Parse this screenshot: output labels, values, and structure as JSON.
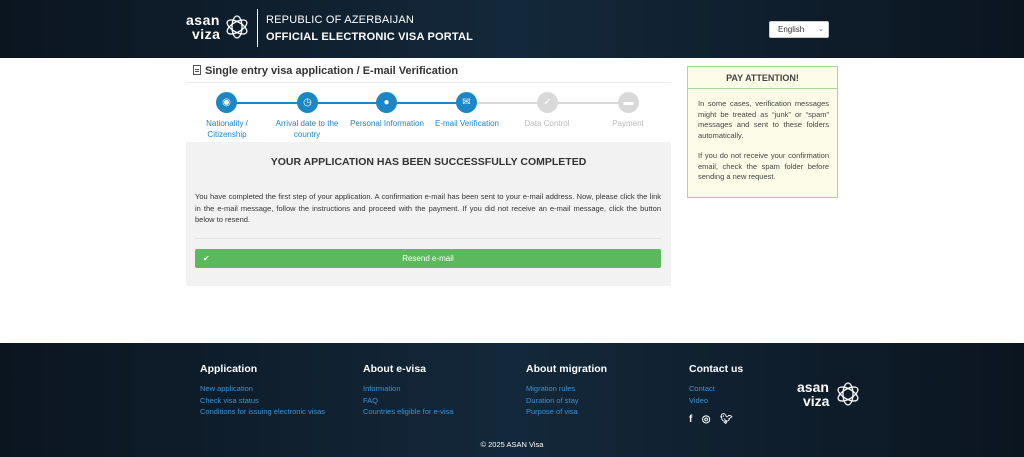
{
  "header": {
    "logo_line1": "asan",
    "logo_line2": "viza",
    "country": "REPUBLIC OF AZERBAIJAN",
    "portal": "OFFICIAL ELECTRONIC VISA PORTAL",
    "language": "English"
  },
  "page_title": "Single entry visa application / E-mail Verification",
  "steps": [
    {
      "label": "Nationality / Citizenship",
      "state": "active",
      "icon": "globe-icon",
      "glyph": "◉"
    },
    {
      "label": "Arrival date to the country",
      "state": "active",
      "icon": "clock-icon",
      "glyph": "◷"
    },
    {
      "label": "Personal Information",
      "state": "active",
      "icon": "user-icon",
      "glyph": "●"
    },
    {
      "label": "E-mail Verification",
      "state": "active",
      "icon": "envelope-icon",
      "glyph": "✉"
    },
    {
      "label": "Data Control",
      "state": "inactive",
      "icon": "check-circle-icon",
      "glyph": "✓"
    },
    {
      "label": "Payment",
      "state": "inactive",
      "icon": "credit-card-icon",
      "glyph": "▬"
    }
  ],
  "panel": {
    "heading": "YOUR APPLICATION HAS BEEN SUCCESSFULLY COMPLETED",
    "text": "You have completed the first step of your application. A confirmation e-mail has been sent to your e-mail address. Now, please click the link in the e-mail message, follow the instructions and proceed with the payment. If you did not receive an e-mail message, click the button below to resend.",
    "button": "Resend e-mail"
  },
  "attention": {
    "title": "PAY ATTENTION!",
    "p1": "In some cases, verification messages might be treated as “junk” or “spam” messages and sent to these folders automatically.",
    "p2": "If you do not receive your confirmation email, check the spam folder before sending a new request."
  },
  "footer": {
    "columns": [
      {
        "title": "Application",
        "links": [
          "New application",
          "Check visa status",
          "Conditions for issuing electronic visas"
        ]
      },
      {
        "title": "About e-visa",
        "links": [
          "Information",
          "FAQ",
          "Countries eligible for e-visa"
        ]
      },
      {
        "title": "About migration",
        "links": [
          "Migration rules",
          "Duration of stay",
          "Purpose of visa"
        ]
      },
      {
        "title": "Contact us",
        "links": [
          "Contact",
          "Video"
        ]
      }
    ],
    "copyright": "© 2025 ASAN Visa"
  },
  "colors": {
    "active": "#1d86c4",
    "inactive": "#d9d9d9",
    "success": "#5cb85c",
    "header_bg": "#0d1a26"
  }
}
